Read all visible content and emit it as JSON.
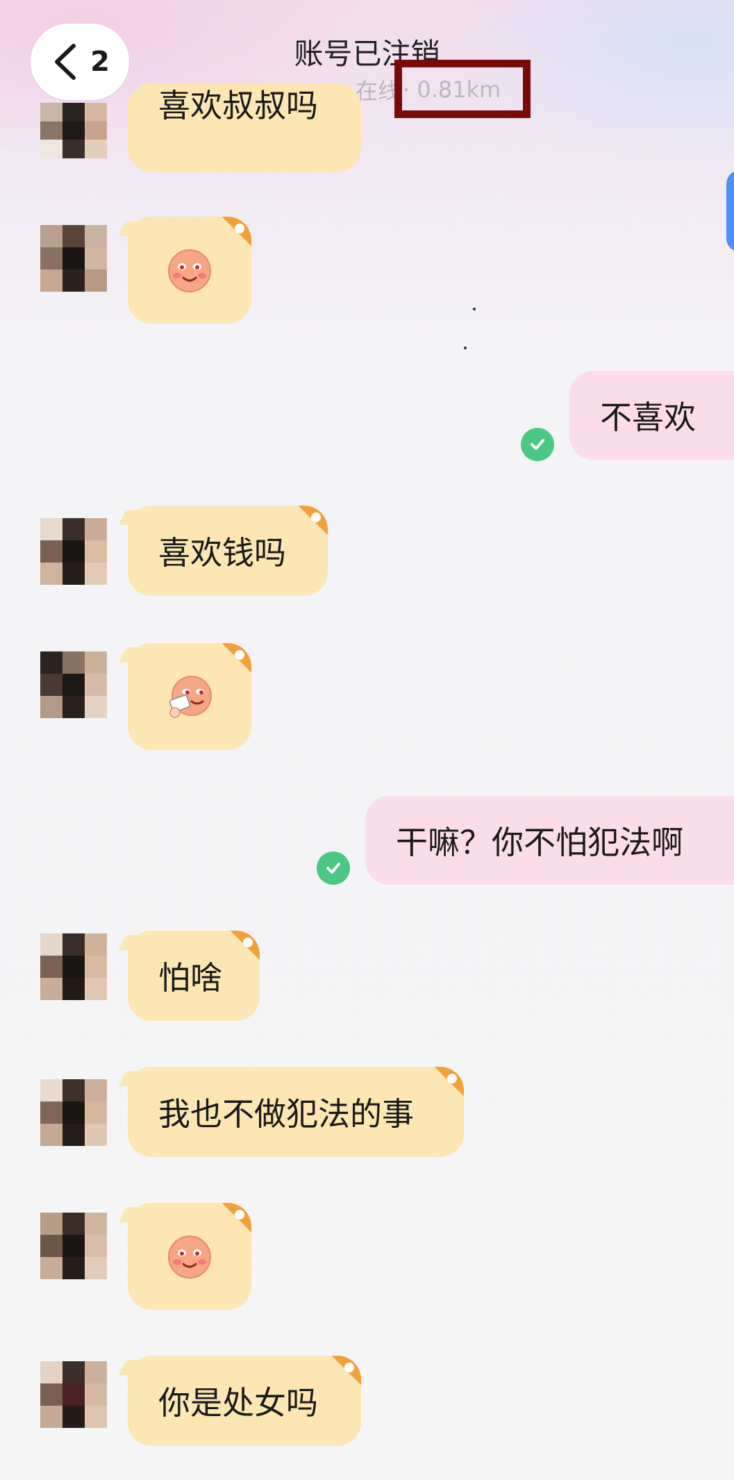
{
  "header": {
    "back_count": "2",
    "title": "账号已注销",
    "status_text": "在线",
    "distance": "· 0.81km"
  },
  "messages": [
    {
      "side": "in",
      "type": "text",
      "text": "喜欢叔叔吗"
    },
    {
      "side": "in",
      "type": "emoji",
      "emoji": "blushing-face-emoji"
    },
    {
      "side": "out",
      "type": "text",
      "text": "不喜欢",
      "read": true
    },
    {
      "side": "in",
      "type": "text",
      "text": "喜欢钱吗"
    },
    {
      "side": "in",
      "type": "emoji",
      "emoji": "money-face-emoji"
    },
    {
      "side": "out",
      "type": "text",
      "text": "干嘛？你不怕犯法啊",
      "read": true
    },
    {
      "side": "in",
      "type": "text",
      "text": "怕啥"
    },
    {
      "side": "in",
      "type": "text",
      "text": "我也不做犯法的事"
    },
    {
      "side": "in",
      "type": "emoji",
      "emoji": "blushing-face-emoji"
    },
    {
      "side": "in",
      "type": "text",
      "text": "你是处女吗"
    }
  ],
  "colors": {
    "incoming_bubble": "#fbe6b4",
    "outgoing_bubble": "#fbdde9",
    "read_check": "#4cc885",
    "online_dot": "#47c773",
    "highlight_box": "#7a0a08"
  }
}
